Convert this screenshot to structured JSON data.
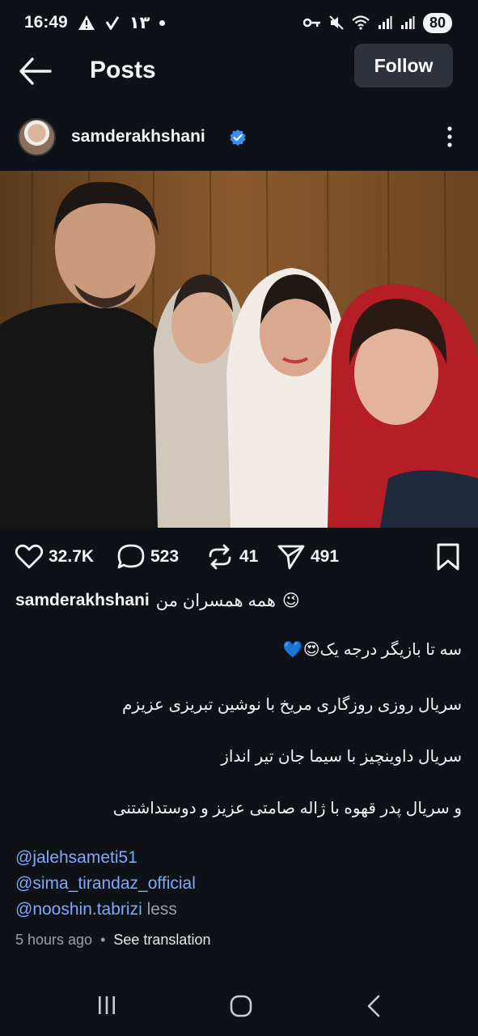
{
  "status_bar": {
    "time": "16:49",
    "extra": "۱۳",
    "battery": "80"
  },
  "header": {
    "title": "Posts",
    "follow_label": "Follow"
  },
  "post": {
    "username": "samderakhshani",
    "likes": "32.7K",
    "comments": "523",
    "reposts": "41",
    "shares": "491",
    "caption_first": "همه همسران من",
    "caption_emoji": "😉",
    "lines": [
      "سه تا بازیگر درجه یک😍💙",
      "سریال روزی روزگاری مریخ با نوشین تبریزی عزیزم",
      "سریال داوینچیز با سیما جان تیر انداز",
      "و سریال پدر قهوه با ژاله صامتی عزیز و دوستداشتنی"
    ],
    "mentions": [
      "@jalehsameti51",
      "@sima_tirandaz_official",
      "@nooshin.tabrizi"
    ],
    "less_label": "less",
    "time_ago": "5 hours ago",
    "see_translation": "See translation"
  },
  "colors": {
    "background": "#0e1116",
    "mention": "#7ea9ff",
    "verified": "#3b8df0"
  },
  "icons": [
    "back-arrow-icon",
    "verified-badge-icon",
    "more-vertical-icon",
    "heart-icon",
    "comment-icon",
    "repost-icon",
    "send-icon",
    "bookmark-icon",
    "recents-icon",
    "home-icon",
    "back-nav-icon"
  ]
}
